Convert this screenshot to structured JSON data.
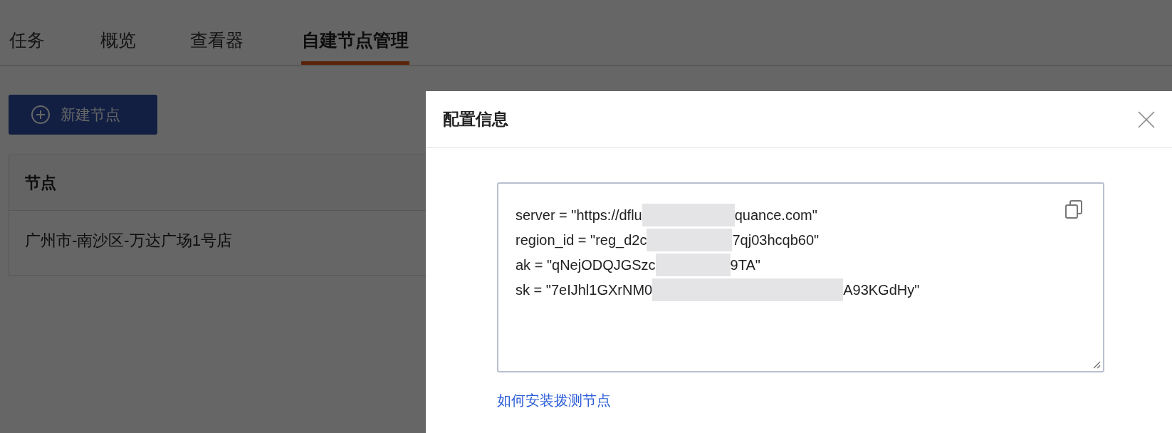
{
  "tabs": [
    {
      "label": "任务",
      "selected": false
    },
    {
      "label": "概览",
      "selected": false
    },
    {
      "label": "查看器",
      "selected": false
    },
    {
      "label": "自建节点管理",
      "selected": true
    }
  ],
  "new_button": {
    "label": "新建节点"
  },
  "table": {
    "columns": [
      "节点"
    ],
    "rows": [
      [
        "广州市-南沙区-万达广场1号店"
      ]
    ]
  },
  "drawer": {
    "title": "配置信息",
    "config_lines": [
      {
        "before": "server = \"https://dflu",
        "after": "quance.com\""
      },
      {
        "before": "region_id = \"reg_d2c",
        "after": "7qj03hcqb60\""
      },
      {
        "before": "ak = \"qNejODQJGSzc",
        "after": "9TA\""
      },
      {
        "before": "sk = \"7eIJhl1GXrNM0",
        "after": "A93KGdHy\""
      }
    ],
    "help_link": "如何安装拨测节点"
  }
}
